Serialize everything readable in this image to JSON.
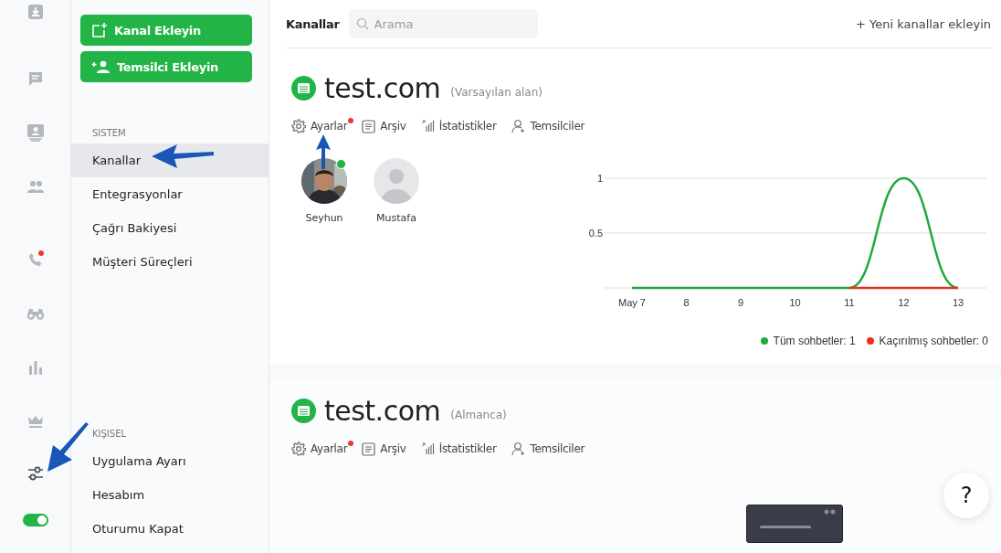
{
  "rail": [
    {
      "kind": "download",
      "selected": false,
      "badge": false
    },
    {
      "kind": "chat",
      "selected": false,
      "badge": false
    },
    {
      "kind": "contact",
      "selected": false,
      "badge": false
    },
    {
      "kind": "people",
      "selected": false,
      "badge": false
    },
    {
      "kind": "phone",
      "selected": false,
      "badge": true
    },
    {
      "kind": "binoculars",
      "selected": false,
      "badge": false
    },
    {
      "kind": "chart",
      "selected": false,
      "badge": false
    },
    {
      "kind": "crown",
      "selected": false,
      "badge": false
    },
    {
      "kind": "sliders",
      "selected": true,
      "badge": false
    }
  ],
  "status_toggle": {
    "on": true
  },
  "sidebar": {
    "buttons": [
      {
        "kind": "add-channel",
        "label": "Kanal Ekleyin"
      },
      {
        "kind": "add-agent",
        "label": "Temsilci Ekleyin"
      }
    ],
    "sections": [
      {
        "title": "SISTEM",
        "items": [
          {
            "label": "Kanallar",
            "selected": true
          },
          {
            "label": "Entegrasyonlar",
            "selected": false
          },
          {
            "label": "Çağrı Bakiyesi",
            "selected": false
          },
          {
            "label": "Müşteri Süreçleri",
            "selected": false
          }
        ]
      },
      {
        "title": "KIŞISEL",
        "items": [
          {
            "label": "Uygulama Ayarı",
            "selected": false
          },
          {
            "label": "Hesabım",
            "selected": false
          },
          {
            "label": "Oturumu Kapat",
            "selected": false
          }
        ]
      }
    ]
  },
  "header": {
    "title": "Kanallar",
    "search": {
      "placeholder": "Arama"
    },
    "add_link": "+ Yeni kanallar ekleyin"
  },
  "channels": [
    {
      "name": "test.com",
      "note": "(Varsayılan alan)",
      "actions": [
        {
          "kind": "settings",
          "label": "Ayarlar",
          "badge": true
        },
        {
          "kind": "archive",
          "label": "Arşiv",
          "badge": false
        },
        {
          "kind": "stats",
          "label": "İstatistikler",
          "badge": false
        },
        {
          "kind": "agents",
          "label": "Temsilciler",
          "badge": false
        }
      ],
      "agents": [
        {
          "name": "Seyhun",
          "online": true
        },
        {
          "name": "Mustafa",
          "kind": "default",
          "online": false
        }
      ],
      "chart_data": {
        "type": "line",
        "categories": [
          "May 7",
          "8",
          "9",
          "10",
          "11",
          "12",
          "13"
        ],
        "ylim": [
          0,
          1
        ],
        "yticks": [
          0.5,
          1
        ],
        "series": [
          {
            "name": "Tüm sohbetler: 1",
            "color": "#22a83a",
            "values": [
              0,
              0,
              0,
              0,
              0,
              1,
              0
            ]
          },
          {
            "name": "Kaçırılmış sohbetler: 0",
            "color": "#e8321e",
            "values": [
              null,
              null,
              null,
              null,
              0,
              0,
              0
            ]
          }
        ]
      }
    },
    {
      "name": "test.com",
      "note": "(Almanca)",
      "actions": [
        {
          "kind": "settings",
          "label": "Ayarlar",
          "badge": true
        },
        {
          "kind": "archive",
          "label": "Arşiv",
          "badge": false
        },
        {
          "kind": "stats",
          "label": "İstatistikler",
          "badge": false
        },
        {
          "kind": "agents",
          "label": "Temsilciler",
          "badge": false
        }
      ]
    }
  ],
  "help": {
    "label": "?"
  }
}
